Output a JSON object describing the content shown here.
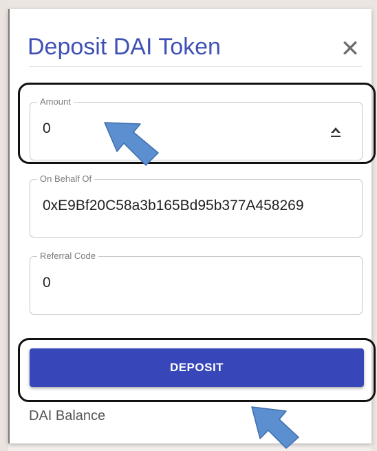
{
  "dialog": {
    "title": "Deposit DAI Token",
    "close_symbol": "✕"
  },
  "form": {
    "amount": {
      "label": "Amount",
      "value": "0"
    },
    "on_behalf_of": {
      "label": "On Behalf Of",
      "value": "0xE9Bf20C58a3b165Bd95b377A458269"
    },
    "referral_code": {
      "label": "Referral Code",
      "value": "0"
    }
  },
  "deposit_button": {
    "label": "DEPOSIT"
  },
  "balance": {
    "label": "DAI Balance"
  },
  "colors": {
    "title": "#3f51b5",
    "button": "#3746b8",
    "highlight_outline": "#111111",
    "arrow": "#5b8fcf"
  }
}
